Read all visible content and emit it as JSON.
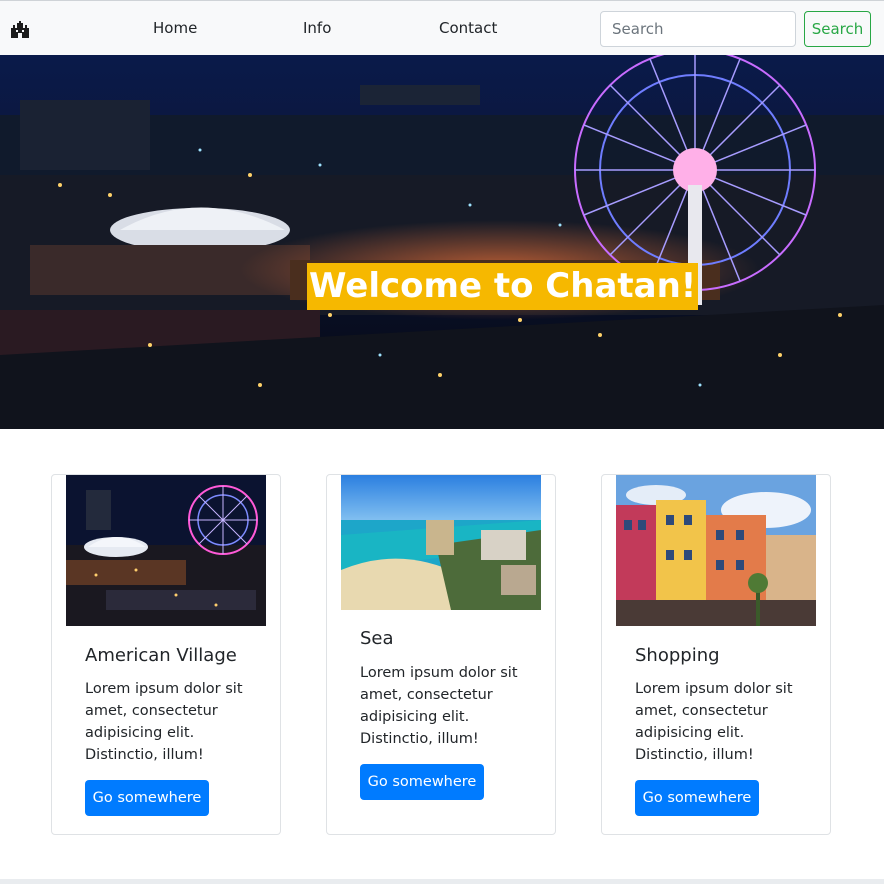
{
  "navbar": {
    "brand_icon": "castle-icon",
    "links": [
      {
        "label": "Home"
      },
      {
        "label": "Info"
      },
      {
        "label": "Contact"
      }
    ],
    "search": {
      "placeholder": "Search",
      "value": "",
      "button_label": "Search"
    }
  },
  "hero": {
    "title": "Welcome to Chatan!",
    "title_bg": "#f6b800"
  },
  "cards": [
    {
      "title": "American Village",
      "text": "Lorem ipsum dolor sit amet, consectetur adipisicing elit. Distinctio, illum!",
      "button_label": "Go somewhere",
      "image": "american-village-night-photo"
    },
    {
      "title": "Sea",
      "text": "Lorem ipsum dolor sit amet, consectetur adipisicing elit. Distinctio, illum!",
      "button_label": "Go somewhere",
      "image": "beach-sea-photo"
    },
    {
      "title": "Shopping",
      "text": "Lorem ipsum dolor sit amet, consectetur adipisicing elit. Distinctio, illum!",
      "button_label": "Go somewhere",
      "image": "colorful-shopping-buildings-photo"
    }
  ],
  "colors": {
    "primary": "#007bff",
    "success": "#28a745",
    "navbar_bg": "#f8f9fa"
  }
}
